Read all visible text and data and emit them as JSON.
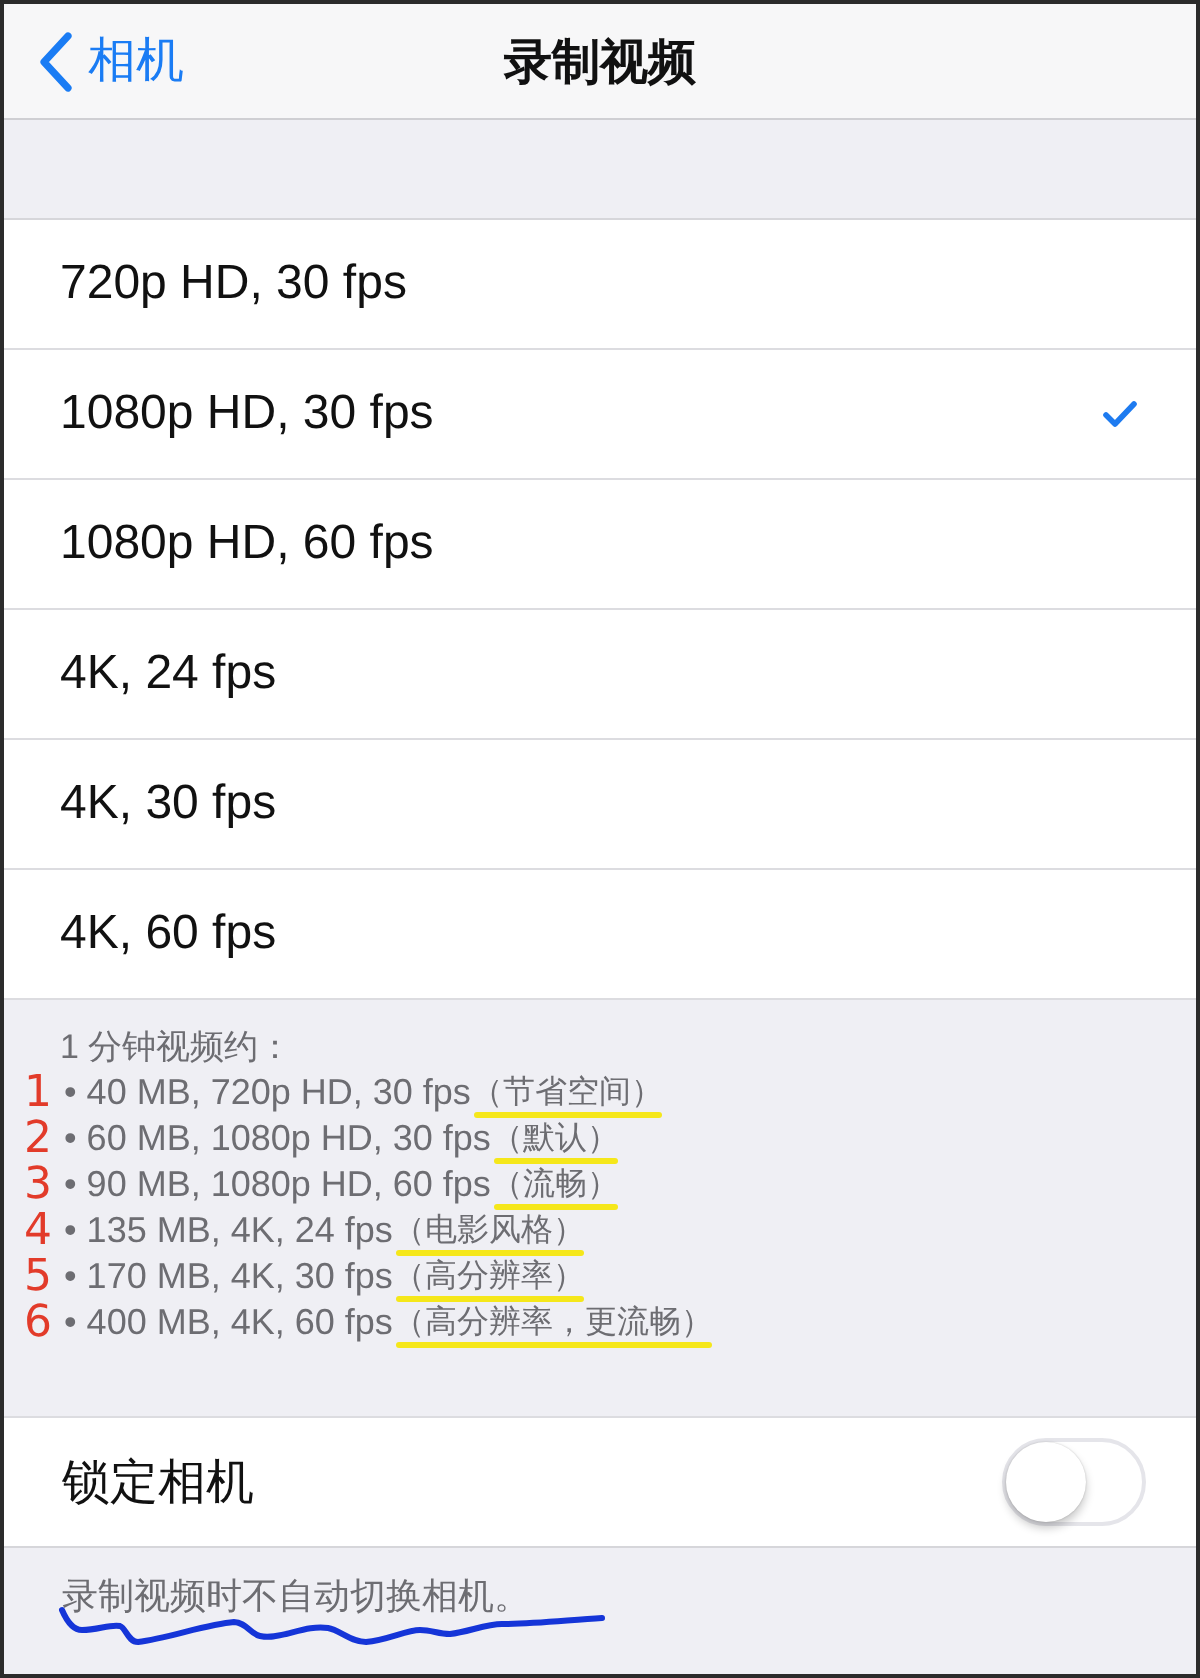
{
  "nav": {
    "back_label": "相机",
    "title": "录制视频"
  },
  "video_formats": [
    {
      "label": "720p HD, 30 fps",
      "selected": false
    },
    {
      "label": "1080p HD, 30 fps",
      "selected": true
    },
    {
      "label": "1080p HD, 60 fps",
      "selected": false
    },
    {
      "label": "4K, 24 fps",
      "selected": false
    },
    {
      "label": "4K, 30 fps",
      "selected": false
    },
    {
      "label": "4K, 60 fps",
      "selected": false
    }
  ],
  "size_info": {
    "heading": "1 分钟视频约：",
    "items": [
      {
        "mark": "1",
        "text": "• 40 MB, 720p HD, 30 fps",
        "note": "（节省空间）",
        "highlighted": true
      },
      {
        "mark": "2",
        "text": "• 60 MB, 1080p HD, 30 fps",
        "note": "（默认）",
        "highlighted": true
      },
      {
        "mark": "3",
        "text": "• 90 MB, 1080p HD, 60 fps",
        "note": "（流畅）",
        "highlighted": true
      },
      {
        "mark": "4",
        "text": "• 135 MB, 4K, 24 fps",
        "note": "（电影风格）",
        "highlighted": true
      },
      {
        "mark": "5",
        "text": "• 170 MB, 4K, 30 fps",
        "note": "（高分辨率）",
        "highlighted": true
      },
      {
        "mark": "6",
        "text": "• 400 MB, 4K, 60 fps",
        "note": "（高分辨率，更流畅）",
        "highlighted": true
      }
    ]
  },
  "lock_camera": {
    "label": "锁定相机",
    "on": false
  },
  "footer": {
    "text": "录制视频时不自动切换相机。",
    "wavy_underline": true
  }
}
